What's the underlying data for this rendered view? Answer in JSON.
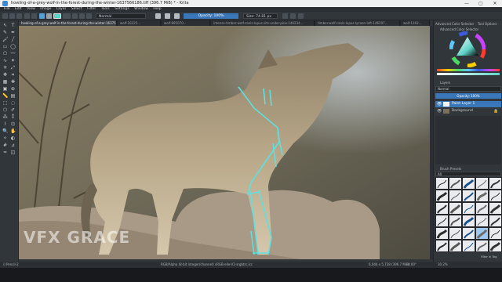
{
  "window": {
    "title": "howling-of-a-grey-wolf-in-the-forest-during-the-winter-1637566186.tiff (396.7 MiB) * - Krita",
    "controls": [
      "—",
      "▢",
      "✕"
    ]
  },
  "menu": [
    "File",
    "Edit",
    "View",
    "Image",
    "Layer",
    "Select",
    "Filter",
    "Tools",
    "Settings",
    "Window",
    "Help"
  ],
  "toolbar": {
    "blend_mode": "Normal",
    "opacity_label": "Opacity: 100%",
    "size_label": "Size: 74.81 px"
  },
  "tabs": [
    "howling-of-a-grey-wolf-in-the-forest-during-the-winter-163756...",
    "wolf-16225...",
    "wolf-895070...",
    "intense-timber-wolf-canis-lupus-sits-under-pine-146234...",
    "timber-wolf-canis-lupus-lycaon-left-146297...",
    "wolf-1162..."
  ],
  "right_panel": {
    "color_tabs": [
      "Advanced Color Selector",
      "Tool Options"
    ],
    "color_section": "Advanced Color Selector",
    "layers_title": "Layers",
    "layer_blend": "Normal",
    "layer_opacity": "Opacity: 100%",
    "layers": [
      {
        "name": "Paint Layer 1",
        "selected": true
      },
      {
        "name": "Background",
        "selected": false
      }
    ],
    "brush_presets_title": "Brush Presets",
    "brush_tag": "All",
    "brush_filter": "Filter in Tag"
  },
  "statusbar": {
    "brush": "i) Pencil-2",
    "color_info": "RGB/Alpha (8-bit integer/channel)  sRGB-elle-V2-srgbtrc.icc",
    "size": "6,044 x 5,728 (396.7 MiB)",
    "angle": "0.00°",
    "zoom": "30.2%"
  },
  "watermark": "VFX GRACE"
}
